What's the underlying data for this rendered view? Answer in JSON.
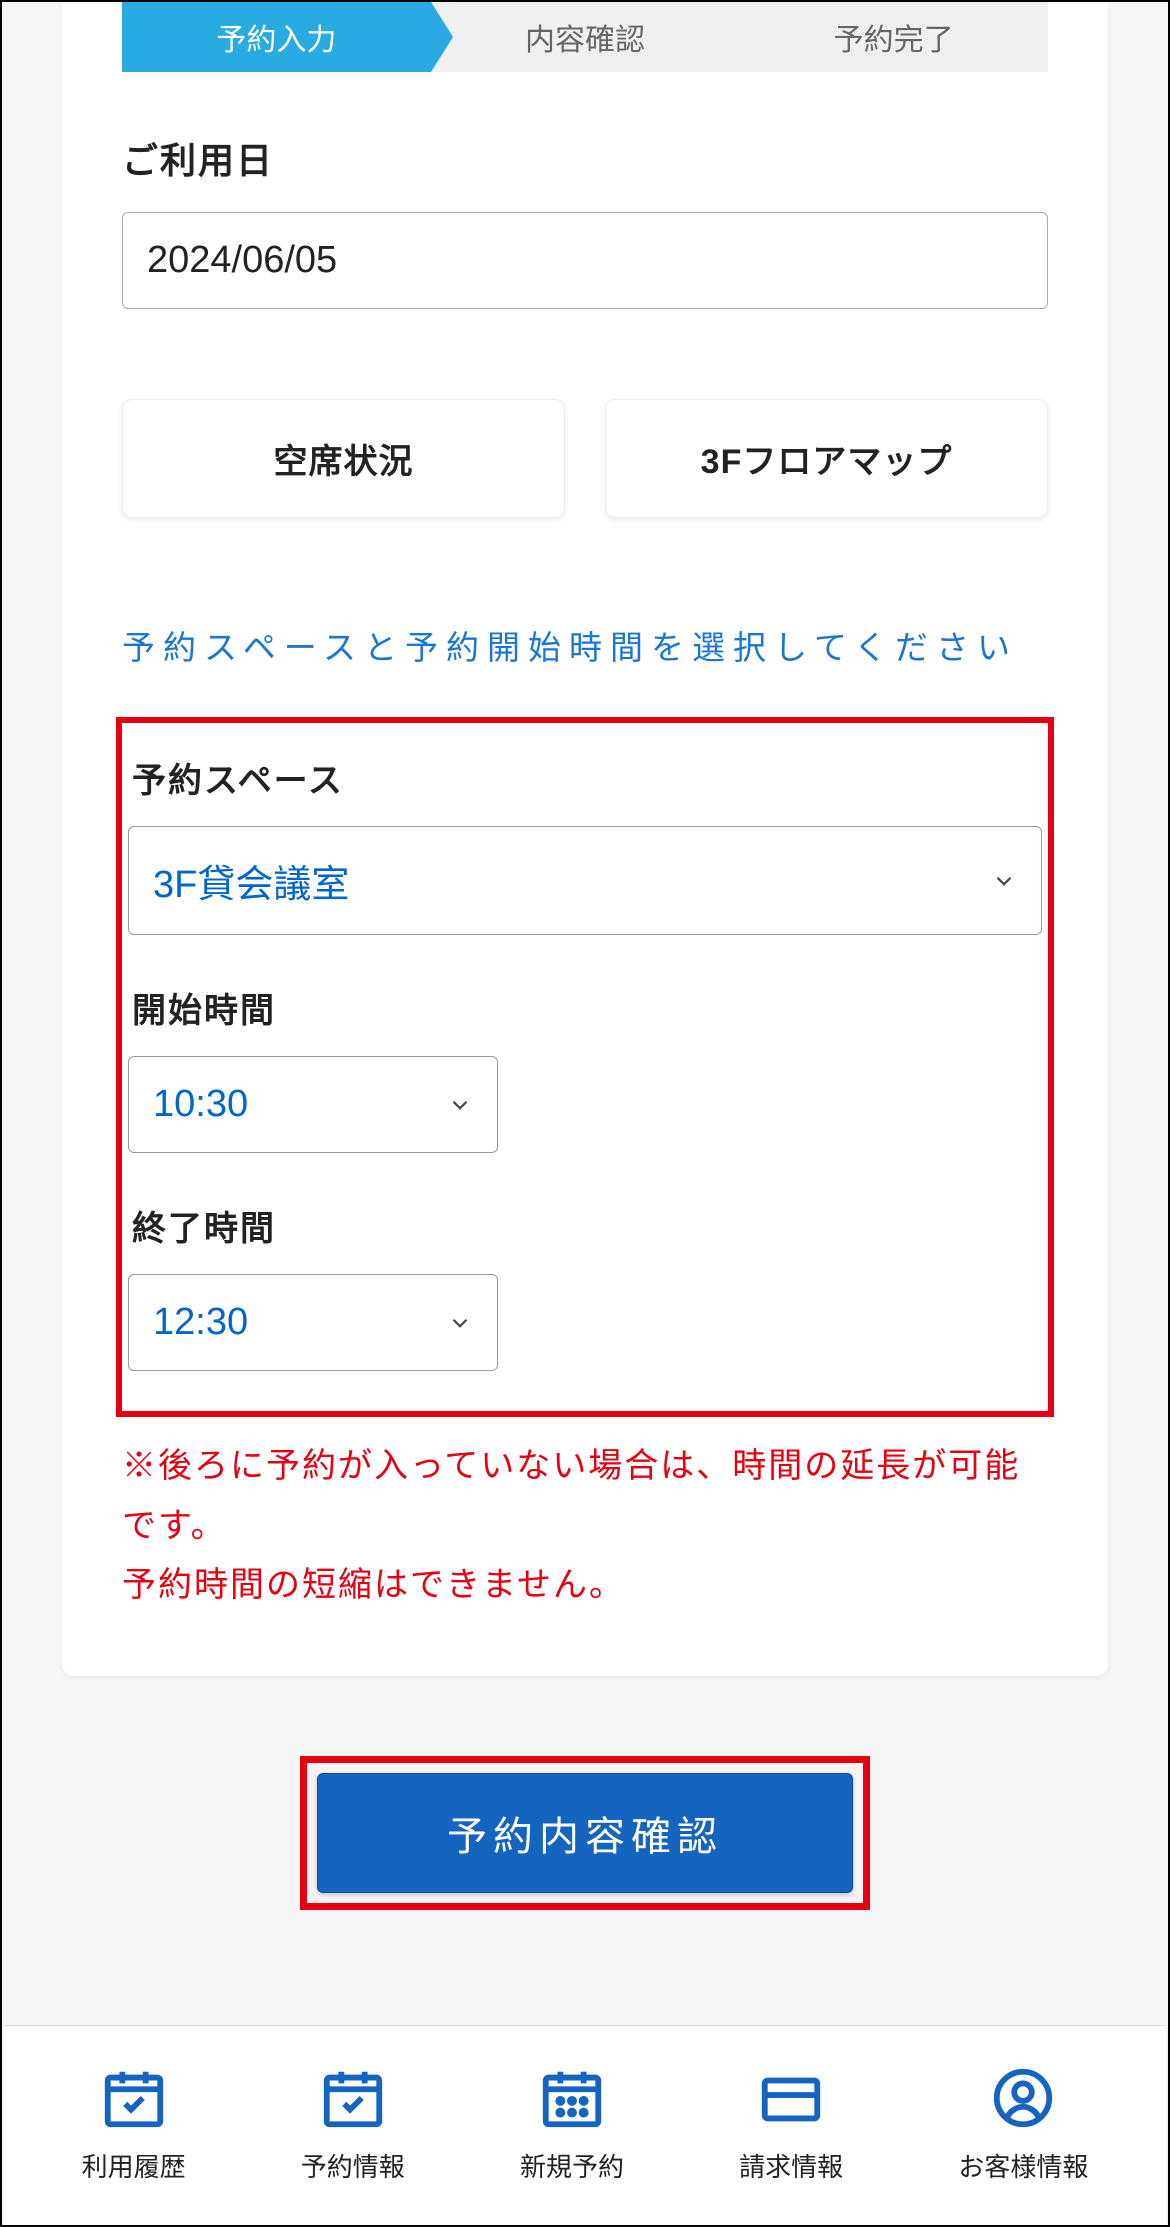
{
  "stepper": {
    "steps": [
      "予約入力",
      "内容確認",
      "予約完了"
    ],
    "active_index": 0
  },
  "date_section": {
    "label": "ご利用日",
    "value": "2024/06/05"
  },
  "buttons": {
    "availability": "空席状況",
    "floormap": "3Fフロアマップ"
  },
  "instruction": "予約スペースと予約開始時間を選択してください",
  "reservation": {
    "space_label": "予約スペース",
    "space_value": "3F貸会議室",
    "start_label": "開始時間",
    "start_value": "10:30",
    "end_label": "終了時間",
    "end_value": "12:30"
  },
  "warning": {
    "line1": "※後ろに予約が入っていない場合は、時間の延長が可能です。",
    "line2": "予約時間の短縮はできません。"
  },
  "confirm_button": "予約内容確認",
  "bottom_nav": {
    "items": [
      {
        "label": "利用履歴",
        "icon": "calendar-check"
      },
      {
        "label": "予約情報",
        "icon": "calendar-check"
      },
      {
        "label": "新規予約",
        "icon": "calendar-grid"
      },
      {
        "label": "請求情報",
        "icon": "card"
      },
      {
        "label": "お客様情報",
        "icon": "user"
      }
    ]
  },
  "colors": {
    "accent_blue": "#29abe2",
    "primary_blue": "#1565c0",
    "link_blue": "#0066cc",
    "warning_red": "#e60012"
  }
}
